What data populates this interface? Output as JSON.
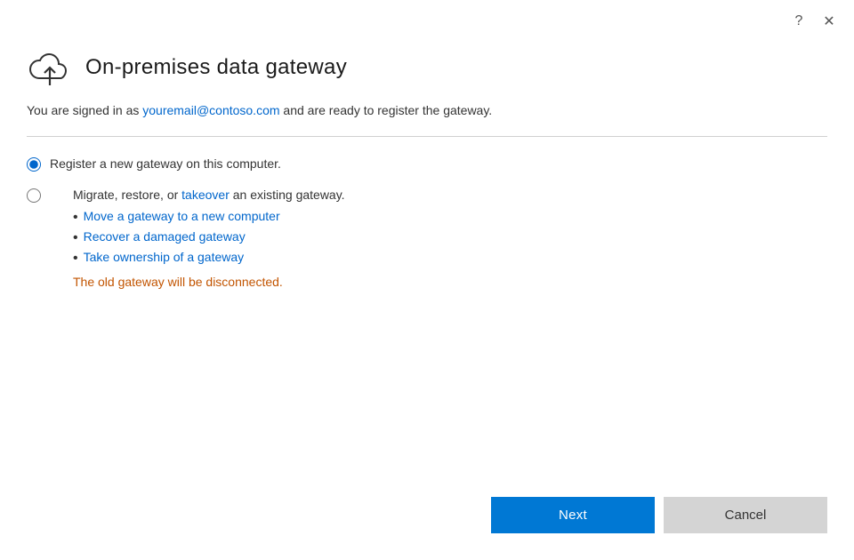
{
  "titlebar": {
    "help_label": "?",
    "close_label": "✕"
  },
  "header": {
    "title": "On-premises data gateway"
  },
  "signed_in": {
    "prefix": "You are signed in as ",
    "email": "youremail@contoso.com",
    "suffix": " and are ready to register the gateway."
  },
  "options": {
    "option1": {
      "label": "Register a new gateway on this computer."
    },
    "option2": {
      "prefix": "Migrate, restore, or ",
      "takeover_text": "takeover",
      "suffix": " an existing gateway.",
      "bullets": [
        "Move a gateway to a new computer",
        "Recover a damaged gateway",
        "Take ownership of a gateway"
      ],
      "note": "The old gateway will be disconnected."
    }
  },
  "buttons": {
    "next": "Next",
    "cancel": "Cancel"
  }
}
